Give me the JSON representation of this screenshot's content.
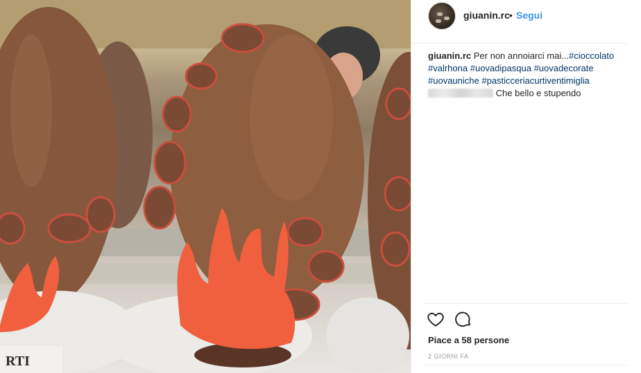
{
  "post": {
    "username": "giuanin.rc",
    "separator": "•",
    "follow_label": "Segui",
    "caption_user": "giuanin.rc",
    "caption_text": "Per non annoiarci mai...",
    "hashtags": [
      "#cioccolato",
      "#valrhona",
      "#uovadipasqua",
      "#uovadecorate",
      "#uovauniche",
      "#pasticceriacurtiventimiglia"
    ],
    "comment_text": "Che bello e stupendo",
    "likes_text": "Piace a 58 persone",
    "time_text": "2 GIORNI FA",
    "photo_label": "RTI"
  },
  "icons": {
    "like": "heart-icon",
    "comment": "comment-icon"
  },
  "colors": {
    "link": "#003569",
    "follow": "#3897f0",
    "chocolate": "#8b5a3c",
    "coral": "#f0603f"
  }
}
